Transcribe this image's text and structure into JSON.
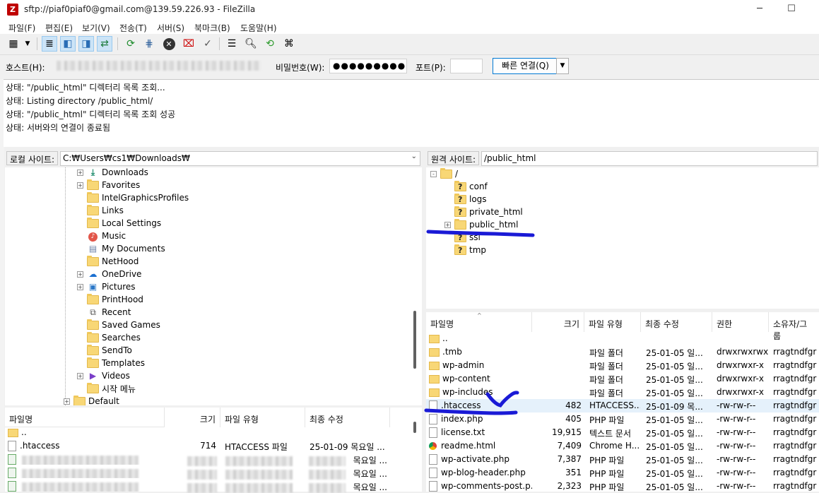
{
  "window": {
    "title": "sftp://piaf0piaf0@gmail.com@139.59.226.93 - FileZilla",
    "minimize": "─",
    "maximize": "☐"
  },
  "menu": [
    "파일(F)",
    "편집(E)",
    "보기(V)",
    "전송(T)",
    "서버(S)",
    "북마크(B)",
    "도움말(H)"
  ],
  "quickconnect": {
    "host_label": "호스트(H):",
    "password_label": "비밀번호(W):",
    "password_value": "●●●●●●●●●",
    "port_label": "포트(P):",
    "port_value": "",
    "connect_label": "빠른 연결(Q)",
    "dropdown": "▼"
  },
  "log": [
    {
      "label": "상태:",
      "text": "\"/public_html\" 디렉터리 목록 조회..."
    },
    {
      "label": "상태:",
      "text": "Listing directory /public_html/"
    },
    {
      "label": "상태:",
      "text": "\"/public_html\" 디렉터리 목록 조회 성공"
    },
    {
      "label": "상태:",
      "text": "서버와의 연결이 종료됨"
    }
  ],
  "local": {
    "path_label": "로컬 사이트:",
    "path": "C:₩Users₩cs1₩Downloads₩",
    "tree": [
      {
        "name": "Downloads",
        "icon": "download-arrow",
        "expander": "+"
      },
      {
        "name": "Favorites",
        "icon": "folder",
        "expander": "+"
      },
      {
        "name": "IntelGraphicsProfiles",
        "icon": "folder",
        "expander": ""
      },
      {
        "name": "Links",
        "icon": "folder",
        "expander": ""
      },
      {
        "name": "Local Settings",
        "icon": "folder",
        "expander": ""
      },
      {
        "name": "Music",
        "icon": "music",
        "expander": ""
      },
      {
        "name": "My Documents",
        "icon": "document",
        "expander": ""
      },
      {
        "name": "NetHood",
        "icon": "folder",
        "expander": ""
      },
      {
        "name": "OneDrive",
        "icon": "cloud",
        "expander": "+"
      },
      {
        "name": "Pictures",
        "icon": "picture",
        "expander": "+"
      },
      {
        "name": "PrintHood",
        "icon": "folder",
        "expander": ""
      },
      {
        "name": "Recent",
        "icon": "recent",
        "expander": ""
      },
      {
        "name": "Saved Games",
        "icon": "folder",
        "expander": ""
      },
      {
        "name": "Searches",
        "icon": "folder",
        "expander": ""
      },
      {
        "name": "SendTo",
        "icon": "folder",
        "expander": ""
      },
      {
        "name": "Templates",
        "icon": "folder",
        "expander": ""
      },
      {
        "name": "Videos",
        "icon": "video",
        "expander": "+"
      },
      {
        "name": "시작 메뉴",
        "icon": "folder",
        "expander": ""
      },
      {
        "name": "Default",
        "icon": "folder",
        "expander": "+"
      }
    ],
    "columns": [
      "파일명",
      "크기",
      "파일 유형",
      "최종 수정"
    ],
    "files": [
      {
        "name": "..",
        "size": "",
        "type": "",
        "modified": ""
      },
      {
        "name": ".htaccess",
        "size": "714",
        "type": "HTACCESS 파일",
        "modified": "25-01-09 목요일 ..."
      },
      {
        "name": "",
        "size": "",
        "type": "",
        "modified": "목요일 ..."
      },
      {
        "name": "",
        "size": "",
        "type": "",
        "modified": "목요일 ..."
      },
      {
        "name": "",
        "size": "",
        "type": "",
        "modified": "목요일 ..."
      }
    ]
  },
  "remote": {
    "path_label": "원격 사이트:",
    "path": "/public_html",
    "tree": [
      {
        "name": "/",
        "level": 0,
        "expander": "-",
        "icon": "folder"
      },
      {
        "name": "conf",
        "level": 1,
        "expander": "",
        "icon": "unknown-folder"
      },
      {
        "name": "logs",
        "level": 1,
        "expander": "",
        "icon": "unknown-folder"
      },
      {
        "name": "private_html",
        "level": 1,
        "expander": "",
        "icon": "unknown-folder"
      },
      {
        "name": "public_html",
        "level": 1,
        "expander": "+",
        "icon": "folder"
      },
      {
        "name": "ssl",
        "level": 1,
        "expander": "",
        "icon": "unknown-folder"
      },
      {
        "name": "tmp",
        "level": 1,
        "expander": "",
        "icon": "unknown-folder"
      }
    ],
    "columns": [
      "파일명",
      "크기",
      "파일 유형",
      "최종 수정",
      "권한",
      "소유자/그룹"
    ],
    "files": [
      {
        "name": "..",
        "size": "",
        "type": "",
        "modified": "",
        "perms": "",
        "owner": "",
        "icon": "folder"
      },
      {
        "name": ".tmb",
        "size": "",
        "type": "파일 폴더",
        "modified": "25-01-05 일...",
        "perms": "drwxrwxrwx",
        "owner": "rragtndfgr",
        "icon": "folder"
      },
      {
        "name": "wp-admin",
        "size": "",
        "type": "파일 폴더",
        "modified": "25-01-05 일...",
        "perms": "drwxrwxr-x",
        "owner": "rragtndfgr",
        "icon": "folder"
      },
      {
        "name": "wp-content",
        "size": "",
        "type": "파일 폴더",
        "modified": "25-01-05 일...",
        "perms": "drwxrwxr-x",
        "owner": "rragtndfgr",
        "icon": "folder"
      },
      {
        "name": "wp-includes",
        "size": "",
        "type": "파일 폴더",
        "modified": "25-01-05 일...",
        "perms": "drwxrwxr-x",
        "owner": "rragtndfgr",
        "icon": "folder"
      },
      {
        "name": ".htaccess",
        "size": "482",
        "type": "HTACCESS...",
        "modified": "25-01-09 목...",
        "perms": "-rw-rw-r--",
        "owner": "rragtndfgr",
        "icon": "file"
      },
      {
        "name": "index.php",
        "size": "405",
        "type": "PHP 파일",
        "modified": "25-01-05 일...",
        "perms": "-rw-rw-r--",
        "owner": "rragtndfgr",
        "icon": "file"
      },
      {
        "name": "license.txt",
        "size": "19,915",
        "type": "텍스트 문서",
        "modified": "25-01-05 일...",
        "perms": "-rw-rw-r--",
        "owner": "rragtndfgr",
        "icon": "file"
      },
      {
        "name": "readme.html",
        "size": "7,409",
        "type": "Chrome H...",
        "modified": "25-01-05 일...",
        "perms": "-rw-rw-r--",
        "owner": "rragtndfgr",
        "icon": "chrome"
      },
      {
        "name": "wp-activate.php",
        "size": "7,387",
        "type": "PHP 파일",
        "modified": "25-01-05 일...",
        "perms": "-rw-rw-r--",
        "owner": "rragtndfgr",
        "icon": "file"
      },
      {
        "name": "wp-blog-header.php",
        "size": "351",
        "type": "PHP 파일",
        "modified": "25-01-05 일...",
        "perms": "-rw-rw-r--",
        "owner": "rragtndfgr",
        "icon": "file"
      },
      {
        "name": "wp-comments-post.p...",
        "size": "2,323",
        "type": "PHP 파일",
        "modified": "25-01-05 일...",
        "perms": "-rw-rw-r--",
        "owner": "rragtndfgr",
        "icon": "file"
      }
    ]
  },
  "colors": {
    "annotation": "#1a1ad6",
    "accent": "#0078d4",
    "selected_row": "#e5f1fb"
  }
}
